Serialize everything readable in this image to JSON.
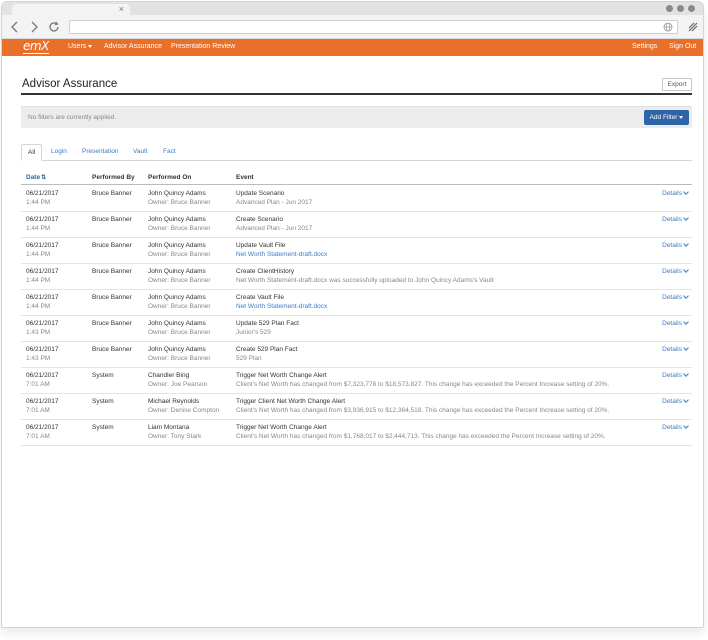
{
  "browser": {
    "url": "",
    "tab_close": "×"
  },
  "appbar": {
    "logo": "emX",
    "nav": {
      "users": "Users",
      "advisor_assurance": "Advisor Assurance",
      "presentation_review": "Presentation Review"
    },
    "settings": "Settings",
    "sign_out": "Sign Out"
  },
  "page": {
    "title": "Advisor Assurance",
    "export_label": "Export",
    "filter_message": "No filters are currently applied.",
    "add_filter_label": "Add Filter"
  },
  "tabs": [
    "All",
    "Login",
    "Presentation",
    "Vault",
    "Fact"
  ],
  "columns": {
    "date": "Date",
    "performed_by": "Performed By",
    "performed_on": "Performed On",
    "event": "Event"
  },
  "rows": [
    {
      "date": "06/21/2017",
      "time": "1:44 PM",
      "by": "Bruce Banner",
      "on": "John Quincy Adams",
      "owner": "Owner: Bruce Banner",
      "event": "Update Scenario",
      "detail": "Advanced Plan - Jun 2017",
      "detail_link": false,
      "details": "Details"
    },
    {
      "date": "06/21/2017",
      "time": "1:44 PM",
      "by": "Bruce Banner",
      "on": "John Quincy Adams",
      "owner": "Owner: Bruce Banner",
      "event": "Create Scenario",
      "detail": "Advanced Plan - Jun 2017",
      "detail_link": false,
      "details": "Details"
    },
    {
      "date": "06/21/2017",
      "time": "1:44 PM",
      "by": "Bruce Banner",
      "on": "John Quincy Adams",
      "owner": "Owner: Bruce Banner",
      "event": "Update Vault File",
      "detail": "Net Worth Statement-draft.docx",
      "detail_link": true,
      "details": "Details"
    },
    {
      "date": "06/21/2017",
      "time": "1:44 PM",
      "by": "Bruce Banner",
      "on": "John Quincy Adams",
      "owner": "Owner: Bruce Banner",
      "event": "Create ClientHistory",
      "detail": "Net Worth Statement-draft.docx was successfully uploaded to John Quincy Adams's Vault",
      "detail_link": false,
      "details": "Details"
    },
    {
      "date": "06/21/2017",
      "time": "1:44 PM",
      "by": "Bruce Banner",
      "on": "John Quincy Adams",
      "owner": "Owner: Bruce Banner",
      "event": "Create Vault File",
      "detail": "Net Worth Statement-draft.docx",
      "detail_link": true,
      "details": "Details"
    },
    {
      "date": "06/21/2017",
      "time": "1:43 PM",
      "by": "Bruce Banner",
      "on": "John Quincy Adams",
      "owner": "Owner: Bruce Banner",
      "event": "Update 529 Plan Fact",
      "detail": "Junior's 529",
      "detail_link": false,
      "details": "Details"
    },
    {
      "date": "06/21/2017",
      "time": "1:43 PM",
      "by": "Bruce Banner",
      "on": "John Quincy Adams",
      "owner": "Owner: Bruce Banner",
      "event": "Create 529 Plan Fact",
      "detail": "529 Plan",
      "detail_link": false,
      "details": "Details"
    },
    {
      "date": "06/21/2017",
      "time": "7:01 AM",
      "by": "System",
      "on": "Chandler Bing",
      "owner": "Owner: Joe Pearson",
      "event": "Trigger Net Worth Change Alert",
      "detail": "Client's Net Worth has changed from $7,323,778 to $18,573,827. This change has exceeded the Percent Increase setting of 20%.",
      "detail_link": false,
      "details": "Details"
    },
    {
      "date": "06/21/2017",
      "time": "7:01 AM",
      "by": "System",
      "on": "Michael Reynolds",
      "owner": "Owner: Denise Compton",
      "event": "Trigger Client Net Worth Change Alert",
      "detail": "Client's Net Worth has changed from $3,936,915 to $12,364,518. This change has exceeded the Percent Increase setting of 20%.",
      "detail_link": false,
      "details": "Details"
    },
    {
      "date": "06/21/2017",
      "time": "7:01 AM",
      "by": "System",
      "on": "Liam Montana",
      "owner": "Owner: Tony Stark",
      "event": "Trigger Net Worth Change Alert",
      "detail": "Client's Net Worth has changed from $1,768,017 to $2,444,713. This change has exceeded the Percent Increase setting of 20%.",
      "detail_link": false,
      "details": "Details"
    }
  ]
}
